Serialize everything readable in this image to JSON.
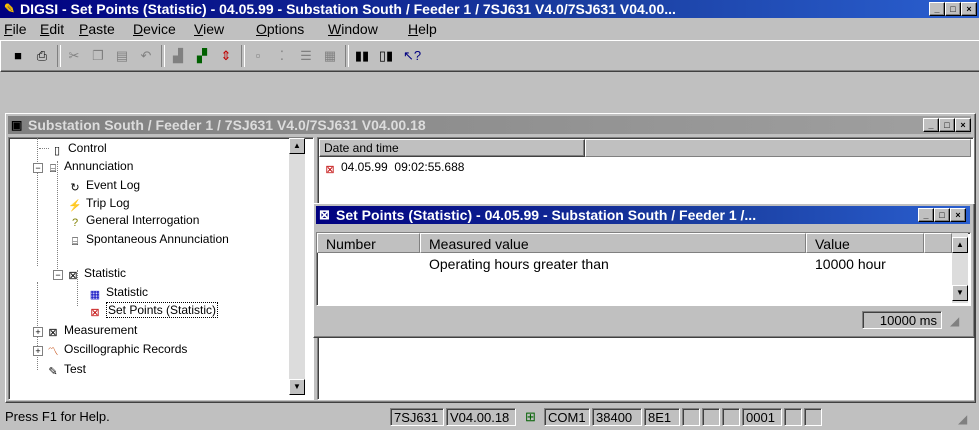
{
  "app": {
    "title": "DIGSI - Set Points (Statistic) - 04.05.99 - Substation South / Feeder 1 / 7SJ631 V4.0/7SJ631 V04.00..."
  },
  "menu": [
    "File",
    "Edit",
    "Paste",
    "Device",
    "View",
    "Options",
    "Window",
    "Help"
  ],
  "toolbar_icons": [
    "save-icon",
    "print-icon",
    "cut-icon",
    "copy-icon",
    "paste-icon",
    "undo-icon",
    "icon-a",
    "icon-b",
    "icon-c",
    "icon-d",
    "icon-e",
    "icon-f",
    "icon-g",
    "icon-h",
    "icon-i",
    "help-icon"
  ],
  "child": {
    "title": "Substation South / Feeder 1 / 7SJ631 V4.0/7SJ631 V04.00.18"
  },
  "tree": [
    {
      "label": "Control"
    },
    {
      "label": "Annunciation"
    },
    {
      "label": "Event Log"
    },
    {
      "label": "Trip Log"
    },
    {
      "label": "General Interrogation"
    },
    {
      "label": "Spontaneous Annunciation"
    },
    {
      "label": "Statistic"
    },
    {
      "label": "Statistic"
    },
    {
      "label": "Set Points (Statistic)"
    },
    {
      "label": "Measurement"
    },
    {
      "label": "Oscillographic Records"
    },
    {
      "label": "Test"
    }
  ],
  "datelist": {
    "header": "Date and time",
    "rows": [
      {
        "date": "04.05.99",
        "time": "09:02:55.688"
      }
    ]
  },
  "popup": {
    "title": "Set Points (Statistic) - 04.05.99 - Substation South / Feeder 1 /...",
    "columns": [
      "Number",
      "Measured value",
      "Value"
    ],
    "rows": [
      {
        "number": "",
        "measured": "Operating hours greater than",
        "value": "10000 hour"
      }
    ],
    "status_value": "10000 ms"
  },
  "statusbar": {
    "help": "Press F1 for Help.",
    "device": "7SJ631",
    "version": "V04.00.18",
    "port": "COM1",
    "baud": "38400",
    "frame": "8E1",
    "address": "0001"
  },
  "window_controls": {
    "min": "_",
    "max": "□",
    "close": "×"
  }
}
